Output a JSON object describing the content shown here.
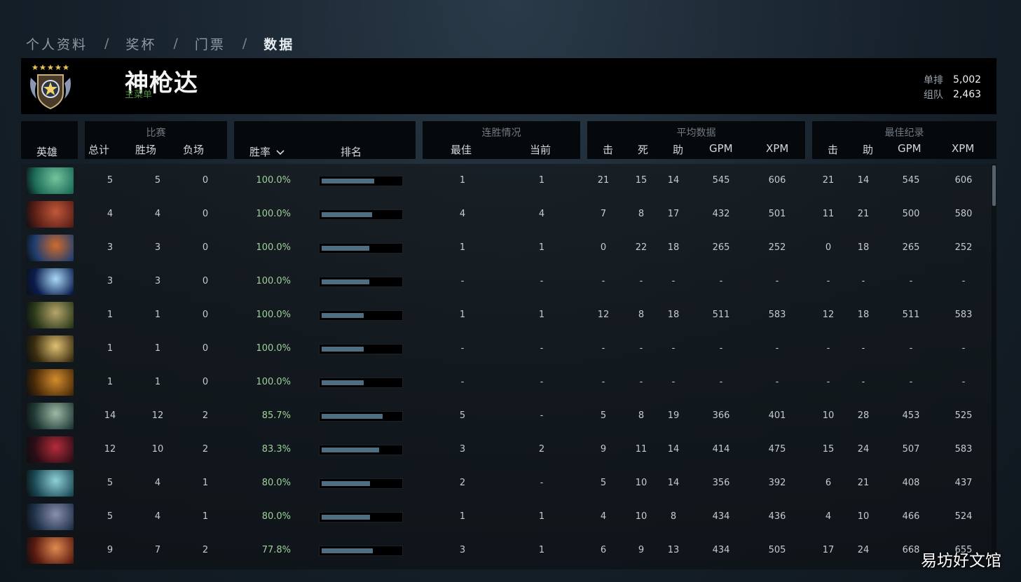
{
  "breadcrumb": {
    "items": [
      "个人资料",
      "奖杯",
      "门票",
      "数据"
    ],
    "separator": "/"
  },
  "profile": {
    "name": "神枪达",
    "subtitle": "主菜单",
    "mmr": {
      "solo_label": "单排",
      "solo_value": "5,002",
      "party_label": "组队",
      "party_value": "2,463"
    }
  },
  "table": {
    "headers": {
      "hero": "英雄",
      "matches": {
        "title": "比赛",
        "total": "总计",
        "wins": "胜场",
        "losses": "负场"
      },
      "winrate": "胜率",
      "rank": "排名",
      "streak": {
        "title": "连胜情况",
        "best": "最佳",
        "current": "当前"
      },
      "average": {
        "title": "平均数据",
        "kills": "击",
        "deaths": "死",
        "assists": "助",
        "gpm": "GPM",
        "xpm": "XPM"
      },
      "best": {
        "title": "最佳纪录",
        "kills": "击",
        "assists": "助",
        "gpm": "GPM",
        "xpm": "XPM"
      }
    },
    "rows": [
      {
        "c": [
          "5",
          "5",
          "0",
          "100.0%",
          "1",
          "1",
          "21",
          "15",
          "14",
          "545",
          "606",
          "21",
          "14",
          "545",
          "606"
        ],
        "rank": 0.67,
        "icon": "hero-portrait-1",
        "colors": [
          "#1c6b57",
          "#73c59e"
        ]
      },
      {
        "c": [
          "4",
          "4",
          "0",
          "100.0%",
          "4",
          "4",
          "7",
          "8",
          "17",
          "432",
          "501",
          "11",
          "21",
          "500",
          "580"
        ],
        "rank": 0.64,
        "icon": "hero-portrait-2",
        "colors": [
          "#5a1e16",
          "#c0583a"
        ]
      },
      {
        "c": [
          "3",
          "3",
          "0",
          "100.0%",
          "1",
          "1",
          "0",
          "22",
          "18",
          "265",
          "252",
          "0",
          "18",
          "265",
          "252"
        ],
        "rank": 0.61,
        "icon": "hero-portrait-3",
        "colors": [
          "#1f3e70",
          "#d06a2c"
        ]
      },
      {
        "c": [
          "3",
          "3",
          "0",
          "100.0%",
          "-",
          "-",
          "-",
          "-",
          "-",
          "-",
          "-",
          "-",
          "-",
          "-",
          "-"
        ],
        "rank": 0.61,
        "icon": "hero-portrait-4",
        "colors": [
          "#0a1c4e",
          "#a9d9f6"
        ]
      },
      {
        "c": [
          "1",
          "1",
          "0",
          "100.0%",
          "1",
          "1",
          "12",
          "8",
          "18",
          "511",
          "583",
          "12",
          "18",
          "511",
          "583"
        ],
        "rank": 0.54,
        "icon": "hero-portrait-5",
        "colors": [
          "#2b3a1a",
          "#b7a56a"
        ]
      },
      {
        "c": [
          "1",
          "1",
          "0",
          "100.0%",
          "-",
          "-",
          "-",
          "-",
          "-",
          "-",
          "-",
          "-",
          "-",
          "-",
          "-"
        ],
        "rank": 0.54,
        "icon": "hero-portrait-6",
        "colors": [
          "#3a2c10",
          "#dfc072"
        ]
      },
      {
        "c": [
          "1",
          "1",
          "0",
          "100.0%",
          "-",
          "-",
          "-",
          "-",
          "-",
          "-",
          "-",
          "-",
          "-",
          "-",
          "-"
        ],
        "rank": 0.54,
        "icon": "hero-portrait-7",
        "colors": [
          "#4a2a08",
          "#d48d2e"
        ]
      },
      {
        "c": [
          "14",
          "12",
          "2",
          "85.7%",
          "5",
          "-",
          "5",
          "8",
          "19",
          "366",
          "401",
          "10",
          "28",
          "453",
          "525"
        ],
        "rank": 0.78,
        "icon": "hero-portrait-8",
        "colors": [
          "#1f3b35",
          "#9fb8a6"
        ]
      },
      {
        "c": [
          "12",
          "10",
          "2",
          "83.3%",
          "3",
          "2",
          "9",
          "11",
          "14",
          "414",
          "475",
          "15",
          "24",
          "507",
          "583"
        ],
        "rank": 0.73,
        "icon": "hero-portrait-9",
        "colors": [
          "#2c0d16",
          "#b52c3a"
        ]
      },
      {
        "c": [
          "5",
          "4",
          "1",
          "80.0%",
          "2",
          "-",
          "5",
          "10",
          "14",
          "356",
          "392",
          "6",
          "21",
          "408",
          "437"
        ],
        "rank": 0.62,
        "icon": "hero-portrait-10",
        "colors": [
          "#1b4a55",
          "#8fd0d6"
        ]
      },
      {
        "c": [
          "5",
          "4",
          "1",
          "80.0%",
          "1",
          "1",
          "4",
          "10",
          "8",
          "434",
          "436",
          "4",
          "10",
          "466",
          "524"
        ],
        "rank": 0.62,
        "icon": "hero-portrait-11",
        "colors": [
          "#20324a",
          "#8a8fb0"
        ]
      },
      {
        "c": [
          "9",
          "7",
          "2",
          "77.8%",
          "3",
          "1",
          "6",
          "9",
          "13",
          "434",
          "505",
          "17",
          "24",
          "668",
          "655"
        ],
        "rank": 0.65,
        "icon": "hero-portrait-12",
        "colors": [
          "#5a1a10",
          "#e08a50"
        ]
      }
    ]
  },
  "watermark": "易坊好文馆"
}
